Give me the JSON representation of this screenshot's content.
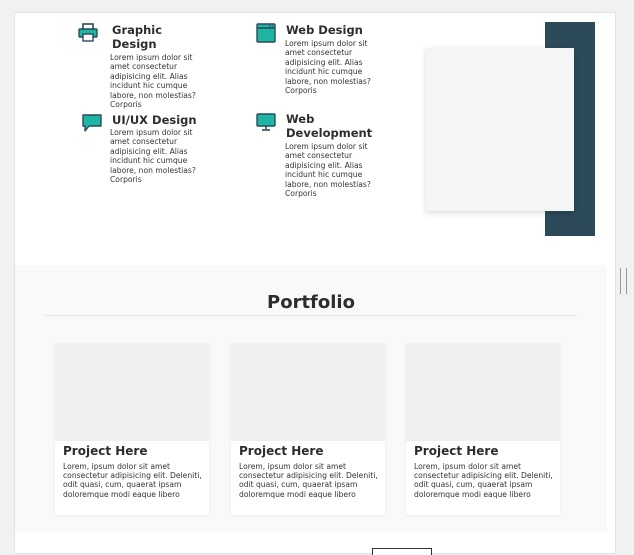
{
  "services": [
    {
      "icon": "printer-icon",
      "title": "Graphic Design",
      "desc": "Lorem ipsum dolor sit amet consectetur adipisicing elit. Alias incidunt hic cumque labore, non molestias? Corporis"
    },
    {
      "icon": "browser-window-icon",
      "title": "Web Design",
      "desc": "Lorem ipsum dolor sit amet consectetur adipisicing elit. Alias incidunt hic cumque labore, non molestias? Corporis"
    },
    {
      "icon": "chat-bubble-icon",
      "title": "UI/UX Design",
      "desc": "Lorem ipsum dolor sit amet consectetur adipisicing elit. Alias incidunt hic cumque labore, non molestias? Corporis"
    },
    {
      "icon": "monitor-icon",
      "title": "Web Development",
      "desc": "Lorem ipsum dolor sit amet consectetur adipisicing elit. Alias incidunt hic cumque labore, non molestias? Corporis"
    }
  ],
  "portfolio": {
    "title": "Portfolio",
    "projects": [
      {
        "title": "Project Here",
        "desc": "Lorem, ipsum dolor sit amet consectetur adipisicing elit. Deleniti, odit quasi, cum, quaerat ipsam doloremque modi eaque libero"
      },
      {
        "title": "Project Here",
        "desc": "Lorem, ipsum dolor sit amet consectetur adipisicing elit. Deleniti, odit quasi, cum, quaerat ipsam doloremque modi eaque libero"
      },
      {
        "title": "Project Here",
        "desc": "Lorem, ipsum dolor sit amet consectetur adipisicing elit. Deleniti, odit quasi, cum, quaerat ipsam doloremque modi eaque libero"
      }
    ]
  },
  "colors": {
    "accent": "#1fb5a5",
    "dark": "#2c4a5a"
  }
}
